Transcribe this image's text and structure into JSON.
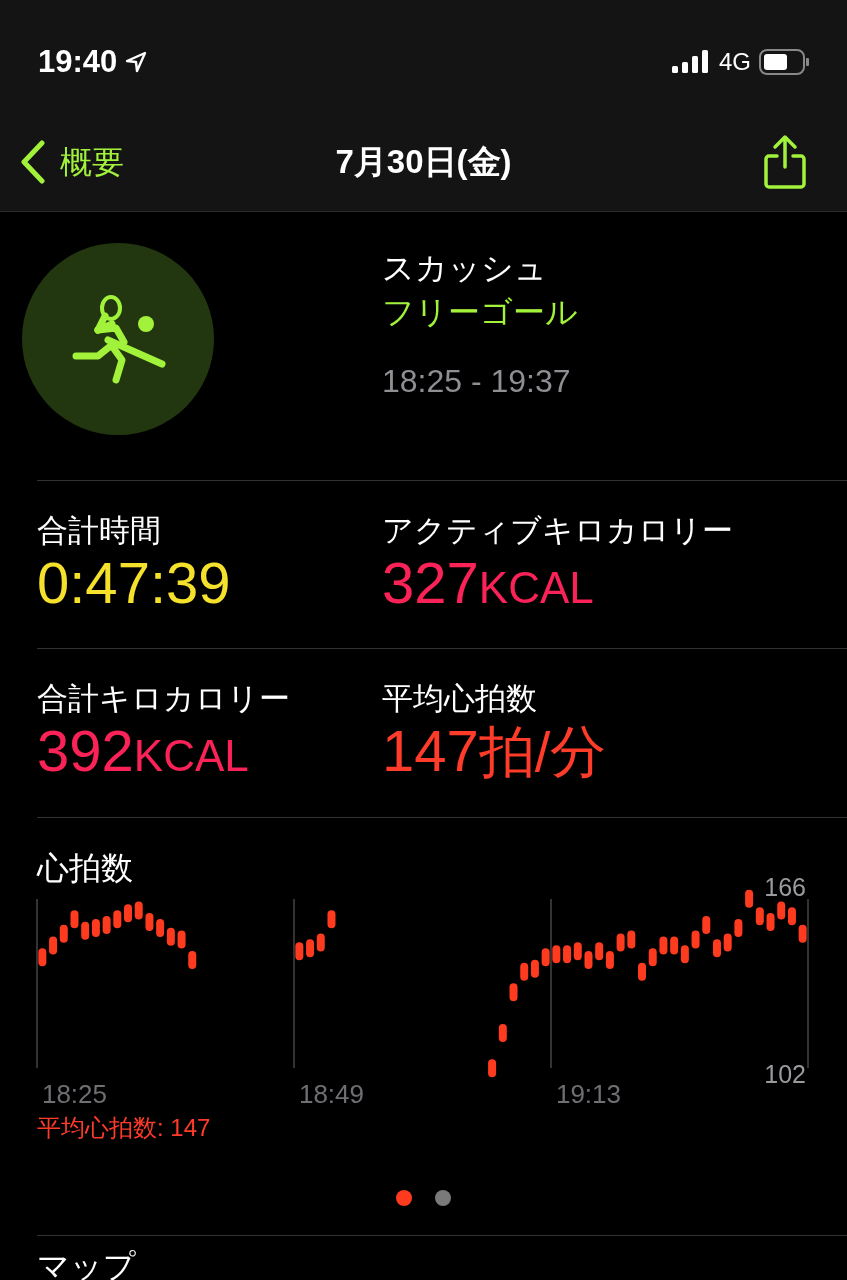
{
  "status_bar": {
    "time": "19:40",
    "network": "4G"
  },
  "nav": {
    "back": "概要",
    "title": "7月30日(金)"
  },
  "workout": {
    "name": "スカッシュ",
    "goal": "フリーゴール",
    "time_range": "18:25 - 19:37"
  },
  "metrics": [
    {
      "label": "合計時間",
      "value": "0:47:39",
      "color": "#f5e12c"
    },
    {
      "label": "アクティブキロカロリー",
      "value": "327",
      "unit": "KCAL",
      "color": "#fa2257"
    },
    {
      "label": "合計キロカロリー",
      "value": "392",
      "unit": "KCAL",
      "color": "#fa2257"
    },
    {
      "label": "平均心拍数",
      "value": "147",
      "unit": "拍/分",
      "color": "#ff3b2a"
    }
  ],
  "heart_rate": {
    "title": "心拍数",
    "average": "平均心拍数: 147",
    "chart_data": {
      "type": "scatter",
      "ylim": [
        102,
        166
      ],
      "yticks": [
        102,
        166
      ],
      "categories": [
        null,
        null,
        null,
        "18:25",
        null,
        null,
        null,
        null,
        null,
        null,
        null,
        null,
        null,
        null,
        null,
        null,
        null,
        null,
        null,
        null,
        null,
        null,
        null,
        null,
        null,
        null,
        null,
        "18:49",
        null,
        null,
        null,
        null,
        null,
        null,
        null,
        null,
        null,
        null,
        null,
        null,
        null,
        null,
        null,
        null,
        null,
        null,
        null,
        null,
        null,
        null,
        null,
        "19:13",
        null,
        null,
        null,
        null,
        null,
        null,
        null,
        null,
        null,
        null,
        null,
        null,
        null,
        null,
        null,
        null,
        null,
        null,
        null,
        null
      ],
      "series": [
        {
          "color": "#ff3b1f",
          "values": [
            142,
            146,
            150,
            155,
            151,
            152,
            153,
            155,
            157,
            158,
            154,
            152,
            149,
            148,
            141,
            null,
            null,
            null,
            null,
            null,
            null,
            null,
            null,
            null,
            144,
            145,
            147,
            155,
            null,
            null,
            null,
            null,
            null,
            null,
            null,
            null,
            null,
            null,
            null,
            null,
            null,
            null,
            104,
            116,
            130,
            137,
            138,
            142,
            143,
            143,
            144,
            141,
            144,
            141,
            147,
            148,
            137,
            142,
            146,
            146,
            143,
            148,
            153,
            145,
            147,
            152,
            162,
            156,
            154,
            158,
            156,
            150
          ]
        }
      ]
    },
    "pages": [
      {
        "selected": true
      },
      {
        "selected": false
      }
    ]
  },
  "map": {
    "title": "マップ"
  }
}
